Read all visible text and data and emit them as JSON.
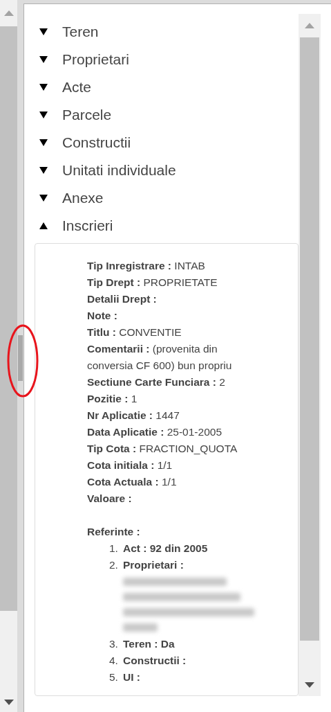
{
  "sections": [
    {
      "label": "Teren",
      "expanded": false
    },
    {
      "label": "Proprietari",
      "expanded": false
    },
    {
      "label": "Acte",
      "expanded": false
    },
    {
      "label": "Parcele",
      "expanded": false
    },
    {
      "label": "Constructii",
      "expanded": false
    },
    {
      "label": "Unitati individuale",
      "expanded": false
    },
    {
      "label": "Anexe",
      "expanded": false
    },
    {
      "label": "Inscrieri",
      "expanded": true
    }
  ],
  "details": {
    "fields": [
      {
        "label": "Tip Inregistrare :",
        "value": "INTAB"
      },
      {
        "label": "Tip Drept :",
        "value": "PROPRIETATE"
      },
      {
        "label": "Detalii Drept :"
      },
      {
        "label": "Note :"
      },
      {
        "label": "Titlu :",
        "value": "CONVENTIE"
      },
      {
        "label": "Comentarii :",
        "value": "(provenita din conversia CF 600) bun propriu"
      },
      {
        "label": "Sectiune Carte Funciara :",
        "value": "2"
      },
      {
        "label": "Pozitie :",
        "value": "1"
      },
      {
        "label": "Nr Aplicatie :",
        "value": "1447"
      },
      {
        "label": "Data Aplicatie :",
        "value": "25-01-2005"
      },
      {
        "label": "Tip Cota :",
        "value": "FRACTION_QUOTA"
      },
      {
        "label": "Cota initiala :",
        "value": "1/1"
      },
      {
        "label": "Cota Actuala :",
        "value": "1/1"
      },
      {
        "label": "Valoare :"
      }
    ],
    "references_label": "Referinte :",
    "references": [
      {
        "number": "1.",
        "text": "Act : 92 din 2005",
        "redacted": false
      },
      {
        "number": "2.",
        "text": "Proprietari :",
        "redacted": true
      },
      {
        "number": "3.",
        "text": "Teren : Da",
        "redacted": false
      },
      {
        "number": "4.",
        "text": "Constructii :",
        "redacted": false
      },
      {
        "number": "5.",
        "text": "UI :",
        "redacted": false
      }
    ]
  },
  "highlight_ellipse": true
}
